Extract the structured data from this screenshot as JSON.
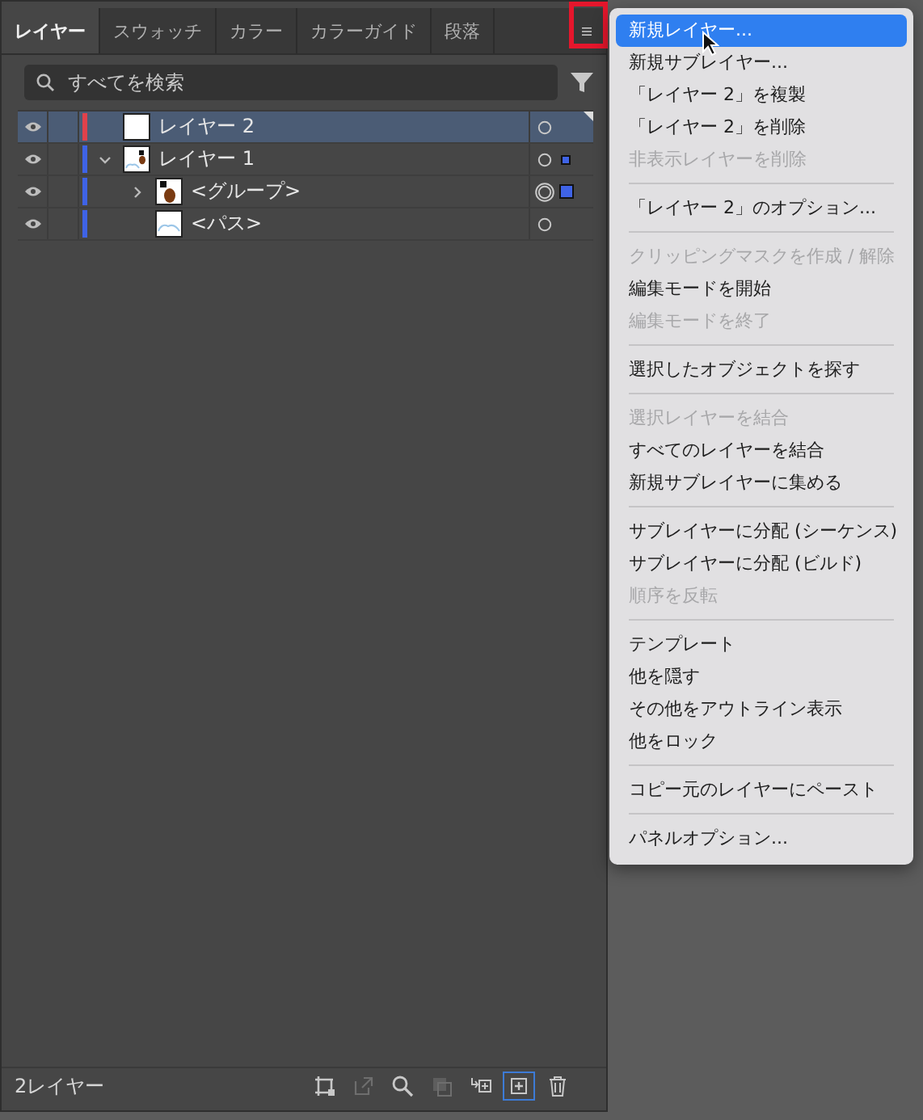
{
  "tabs": [
    {
      "label": "レイヤー",
      "selected": true
    },
    {
      "label": "スウォッチ",
      "selected": false
    },
    {
      "label": "カラー",
      "selected": false
    },
    {
      "label": "カラーガイド",
      "selected": false
    },
    {
      "label": "段落",
      "selected": false
    }
  ],
  "search": {
    "placeholder": "すべてを検索"
  },
  "layers": [
    {
      "name": "レイヤー 2",
      "kind": "layer",
      "color": "#e0414b",
      "selected": true,
      "art_selected": false,
      "appearance": false
    },
    {
      "name": "レイヤー 1",
      "kind": "layer",
      "color": "#3f63e6",
      "selected": false,
      "expanded": true,
      "art_selected": true,
      "appearance": false,
      "children": [
        {
          "name": "<グループ>",
          "kind": "group",
          "selected": false,
          "expanded": false,
          "art_selected": true,
          "appearance": true
        },
        {
          "name": "<パス>",
          "kind": "path",
          "selected": false,
          "art_selected": false,
          "appearance": false
        }
      ]
    }
  ],
  "footer": {
    "count": "2レイヤー",
    "tools": [
      {
        "kind": "artboard",
        "disabled": false,
        "selected": false
      },
      {
        "kind": "export",
        "disabled": true,
        "selected": false
      },
      {
        "kind": "search",
        "disabled": false,
        "selected": false
      },
      {
        "kind": "mask",
        "disabled": true,
        "selected": false
      },
      {
        "kind": "sublayer",
        "disabled": false,
        "selected": false
      },
      {
        "kind": "new",
        "disabled": false,
        "selected": true
      },
      {
        "kind": "trash",
        "disabled": false,
        "selected": false
      }
    ]
  },
  "menu": [
    [
      {
        "label": "新規レイヤー...",
        "disabled": false,
        "selected": true
      },
      {
        "label": "新規サブレイヤー...",
        "disabled": false,
        "selected": false
      },
      {
        "label": "「レイヤー 2」を複製",
        "disabled": false,
        "selected": false
      },
      {
        "label": "「レイヤー 2」を削除",
        "disabled": false,
        "selected": false
      },
      {
        "label": "非表示レイヤーを削除",
        "disabled": true,
        "selected": false
      }
    ],
    [
      {
        "label": "「レイヤー 2」のオプション...",
        "disabled": false,
        "selected": false
      }
    ],
    [
      {
        "label": "クリッピングマスクを作成 / 解除",
        "disabled": true,
        "selected": false
      },
      {
        "label": "編集モードを開始",
        "disabled": false,
        "selected": false
      },
      {
        "label": "編集モードを終了",
        "disabled": true,
        "selected": false
      }
    ],
    [
      {
        "label": "選択したオブジェクトを探す",
        "disabled": false,
        "selected": false
      }
    ],
    [
      {
        "label": "選択レイヤーを結合",
        "disabled": true,
        "selected": false
      },
      {
        "label": "すべてのレイヤーを結合",
        "disabled": false,
        "selected": false
      },
      {
        "label": "新規サブレイヤーに集める",
        "disabled": false,
        "selected": false
      }
    ],
    [
      {
        "label": "サブレイヤーに分配 (シーケンス)",
        "disabled": false,
        "selected": false
      },
      {
        "label": "サブレイヤーに分配 (ビルド)",
        "disabled": false,
        "selected": false
      },
      {
        "label": "順序を反転",
        "disabled": true,
        "selected": false
      }
    ],
    [
      {
        "label": "テンプレート",
        "disabled": false,
        "selected": false
      },
      {
        "label": "他を隠す",
        "disabled": false,
        "selected": false
      },
      {
        "label": "その他をアウトライン表示",
        "disabled": false,
        "selected": false
      },
      {
        "label": "他をロック",
        "disabled": false,
        "selected": false
      }
    ],
    [
      {
        "label": "コピー元のレイヤーにペースト",
        "disabled": false,
        "selected": false
      }
    ],
    [
      {
        "label": "パネルオプション...",
        "disabled": false,
        "selected": false
      }
    ]
  ]
}
